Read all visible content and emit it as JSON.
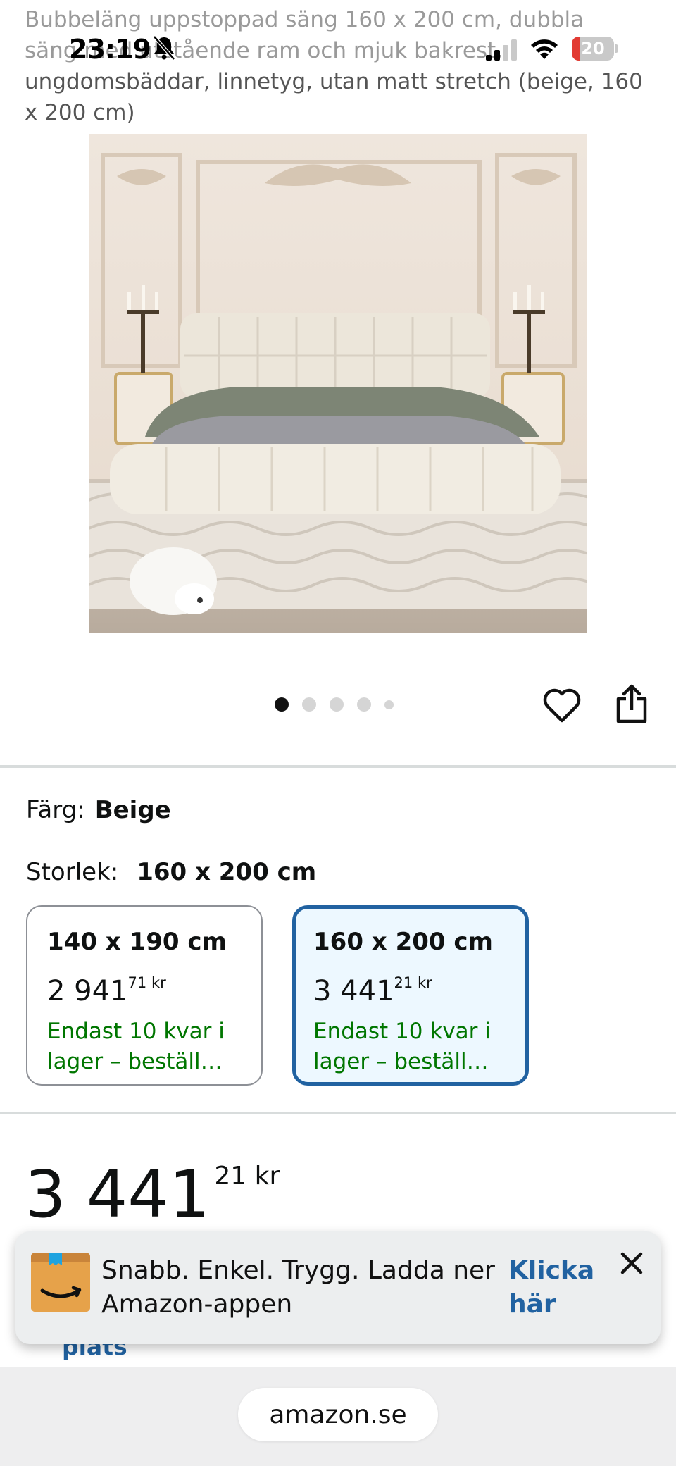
{
  "product": {
    "title_line1": "Bubbeläng uppstoppad säng 160 x 200 cm, dubbla",
    "title_line2": "säng med utstående ram och mjuk bakrest,",
    "title_line3": "ungdomsbäddar, linnetyg, utan matt stretch (beige, 160",
    "title_line4": "x 200 cm)"
  },
  "status_bar": {
    "time": "23:19",
    "battery": "20",
    "icons": [
      "bell-slash-icon",
      "signal-icon",
      "wifi-icon",
      "battery-icon"
    ]
  },
  "gallery": {
    "dot_count": 5,
    "active_index": 0,
    "icons": [
      "heart-icon",
      "share-icon"
    ]
  },
  "variations": {
    "color_label": "Färg:",
    "color_value": "Beige",
    "size_label": "Storlek:",
    "size_value": "160 x 200 cm",
    "options": [
      {
        "size": "140 x 190 cm",
        "price_whole": "2 941",
        "price_fraction": "71",
        "currency": "kr",
        "stock_line1": "Endast 10 kvar i",
        "stock_line2": "lager – beställ…",
        "selected": false
      },
      {
        "size": "160 x 200 cm",
        "price_whole": "3 441",
        "price_fraction": "21",
        "currency": "kr",
        "stock_line1": "Endast 10 kvar i",
        "stock_line2": "lager – beställ…",
        "selected": true
      }
    ]
  },
  "price": {
    "whole": "3 441",
    "fraction": "21",
    "currency": "kr"
  },
  "peek_text": "plats",
  "app_banner": {
    "line1": "Snabb. Enkel. Trygg. Ladda ner",
    "line2": "Amazon-appen",
    "cta_line1": "Klicka",
    "cta_line2": "här",
    "icon": "amazon-app-icon",
    "close_icon": "close-icon"
  },
  "browser": {
    "url": "amazon.se"
  },
  "colors": {
    "link": "#2162a1",
    "stock": "#007600",
    "selected_bg": "#edf8ff"
  }
}
